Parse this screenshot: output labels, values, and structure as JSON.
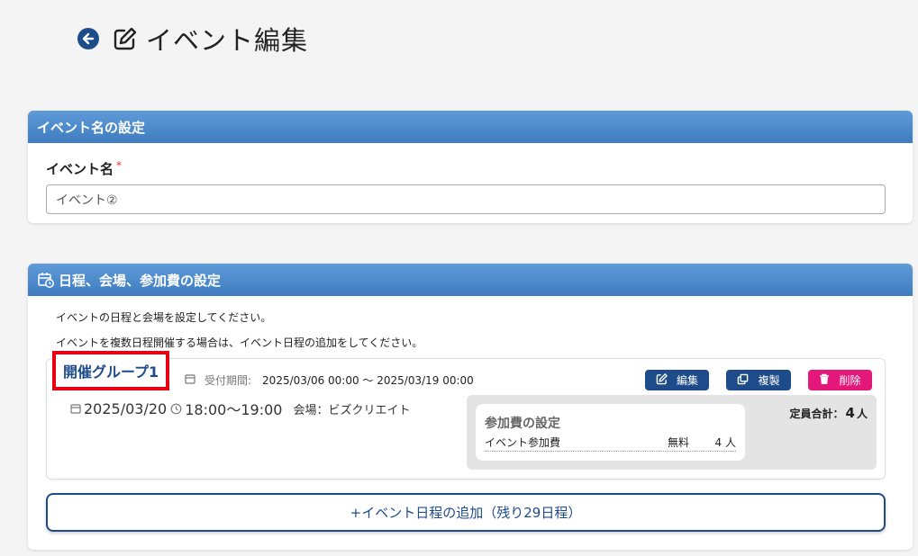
{
  "page": {
    "title": "イベント編集",
    "back_icon": "back-arrow-icon",
    "title_icon": "edit-pen-icon"
  },
  "event_name_section": {
    "header": "イベント名の設定",
    "field_label": "イベント名",
    "required_mark": "*",
    "value": "イベント②"
  },
  "schedule_section": {
    "header": "日程、会場、参加費の設定",
    "header_icon": "calendar-clock-icon",
    "desc1": "イベントの日程と会場を設定してください。",
    "desc2": "イベントを複数日程開催する場合は、イベント日程の追加をしてください。",
    "group": {
      "name": "開催グループ1",
      "period_label": "受付期間:",
      "period_value": "2025/03/06 00:00 ～ 2025/03/19 00:00",
      "buttons": {
        "edit": "編集",
        "copy": "複製",
        "delete": "削除"
      },
      "date": "2025/03/20",
      "time": "18:00～19:00",
      "venue": "会場：ビズクリエイト",
      "capacity_label": "定員合計：",
      "capacity_value": "4",
      "capacity_unit": "人",
      "fee": {
        "title": "参加費の設定",
        "item_name": "イベント参加費",
        "price": "無料",
        "count": "4 人"
      }
    },
    "add_button": "+イベント日程の追加（残り29日程）"
  },
  "colors": {
    "primary": "#1e4c8a",
    "header_blue": "#4a88cc",
    "delete_pink": "#e4187a",
    "highlight_red": "#e60012"
  }
}
